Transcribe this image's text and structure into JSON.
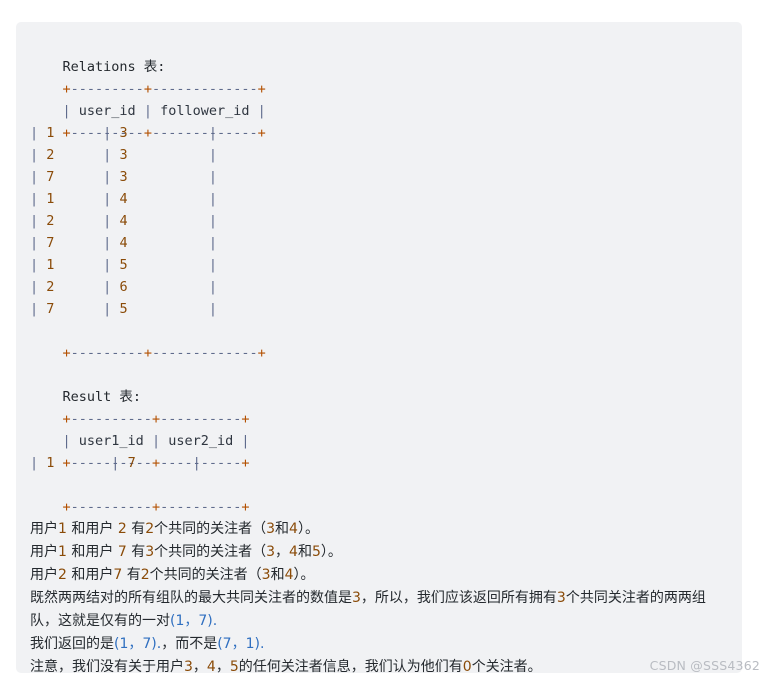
{
  "code_block": {
    "background": "#f1f2f4",
    "relations_heading": "Relations 表:",
    "result_heading": "Result 表:",
    "relations_table": {
      "rule": "+---------+-------------+",
      "header_cells": [
        "user_id",
        "follower_id"
      ],
      "header_row": "| user_id | follower_id |",
      "rows": [
        {
          "user_id": "1",
          "follower_id": "3"
        },
        {
          "user_id": "2",
          "follower_id": "3"
        },
        {
          "user_id": "7",
          "follower_id": "3"
        },
        {
          "user_id": "1",
          "follower_id": "4"
        },
        {
          "user_id": "2",
          "follower_id": "4"
        },
        {
          "user_id": "7",
          "follower_id": "4"
        },
        {
          "user_id": "1",
          "follower_id": "5"
        },
        {
          "user_id": "2",
          "follower_id": "6"
        },
        {
          "user_id": "7",
          "follower_id": "5"
        }
      ]
    },
    "result_table": {
      "rule": "+----------+----------+",
      "header_cells": [
        "user1_id",
        "user2_id"
      ],
      "header_row": "| user1_id | user2_id |",
      "rows": [
        {
          "user1_id": "1",
          "user2_id": "7"
        }
      ]
    },
    "explanation": [
      "用户1 和用户 2 有2个共同的关注者（3和4）。",
      "用户1 和用户 7 有3个共同的关注者（3，4和5）。",
      "用户2 和用户7 有2个共同的关注者（3和4）。",
      "既然两两结对的所有组队的最大共同关注者的数值是3，所以，我们应该返回所有拥有3个共同关注者的两两组队，这就是仅有的一对(1，7).",
      "我们返回的是(1，7).，而不是(7，1).",
      "注意，我们没有关于用户3，4，5的任何关注者信息，我们认为他们有0个关注者。"
    ]
  },
  "watermark": {
    "text": "CSDN @SSS4362",
    "color": "#b9bcc2"
  },
  "colors": {
    "plus": "#b35000",
    "border": "#5f6b8c",
    "number": "#8a4b08",
    "text": "#24292e",
    "blue": "#2f6fc0"
  }
}
